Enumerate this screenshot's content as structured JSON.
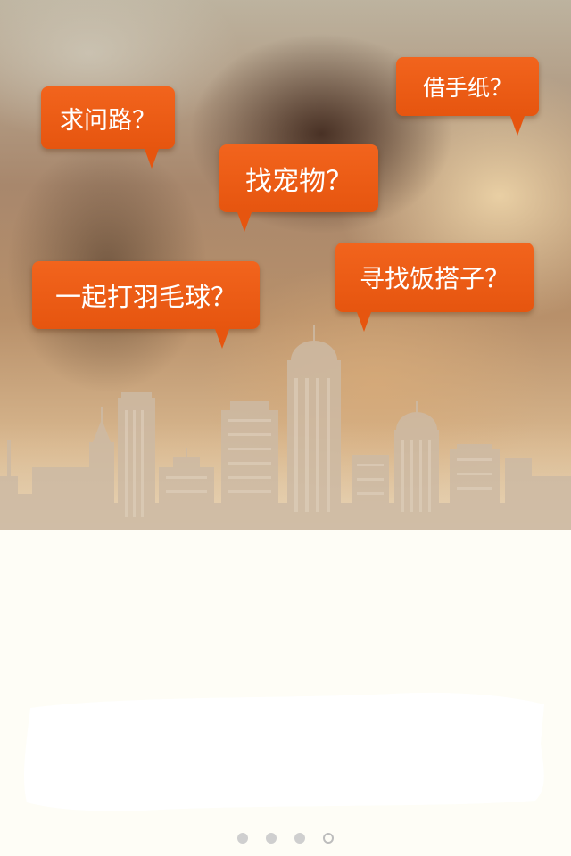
{
  "bubbles": [
    {
      "text": "求问路？"
    },
    {
      "text": "借手纸？"
    },
    {
      "text": "找宠物？"
    },
    {
      "text": "一起打羽毛球？"
    },
    {
      "text": "寻找饭搭子？"
    }
  ],
  "pager": {
    "count": 4,
    "active_index": 3
  },
  "colors": {
    "bubble": "#e6550f",
    "bubble_text": "#ffffff",
    "page_background": "#fefdf6",
    "skyline": "#cdbaa4"
  },
  "icons": {
    "skyline": "city-skyline-illustration"
  }
}
